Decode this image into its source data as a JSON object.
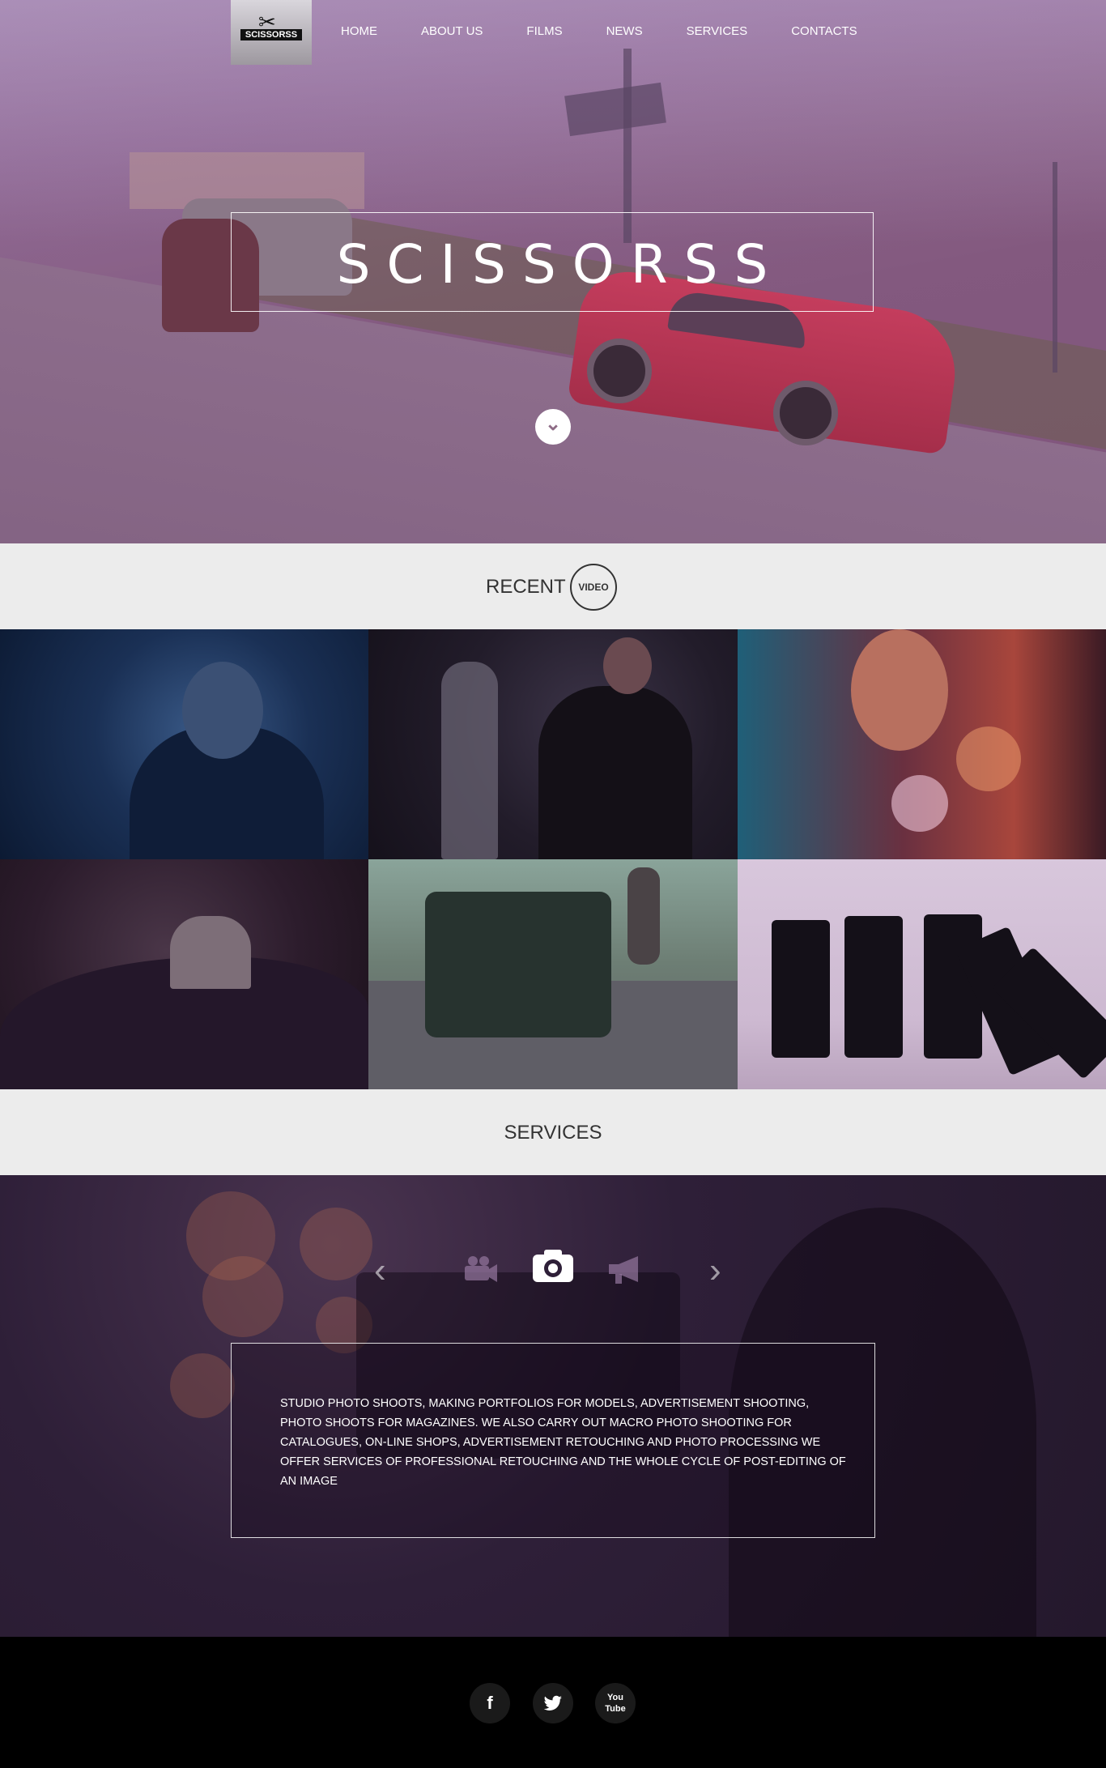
{
  "nav": {
    "logo_text": "SCISSORSS",
    "items": [
      "HOME",
      "ABOUT US",
      "FILMS",
      "NEWS",
      "SERVICES",
      "CONTACTS"
    ]
  },
  "hero": {
    "title": "SCISSORSS",
    "scroll_icon": "chevron-down-circle-icon"
  },
  "recent": {
    "label": "RECENT",
    "badge": "VIDEO"
  },
  "services": {
    "title": "SERVICES",
    "icons": [
      "chevron-left-icon",
      "video-camera-icon",
      "photo-camera-icon",
      "megaphone-icon",
      "chevron-right-icon"
    ],
    "active_icon": "photo-camera-icon",
    "description": "STUDIO PHOTO SHOOTS, MAKING PORTFOLIOS FOR MODELS, ADVERTISEMENT SHOOTING, PHOTO SHOOTS FOR MAGAZINES. WE ALSO CARRY OUT MACRO PHOTO SHOOTING FOR CATALOGUES, ON-LINE SHOPS, ADVERTISEMENT RETOUCHING AND PHOTO PROCESSING WE OFFER SERVICES OF PROFESSIONAL RETOUCHING AND THE WHOLE CYCLE OF POST-EDITING OF AN IMAGE"
  },
  "footer": {
    "social": [
      "facebook-icon",
      "twitter-icon",
      "youtube-icon"
    ],
    "youtube_label_top": "You",
    "youtube_label_bottom": "Tube"
  },
  "colors": {
    "hero_tint": "#8e6c86",
    "section_bg": "#ececec",
    "services_bg": "#2e1f38",
    "footer_bg": "#000000"
  }
}
